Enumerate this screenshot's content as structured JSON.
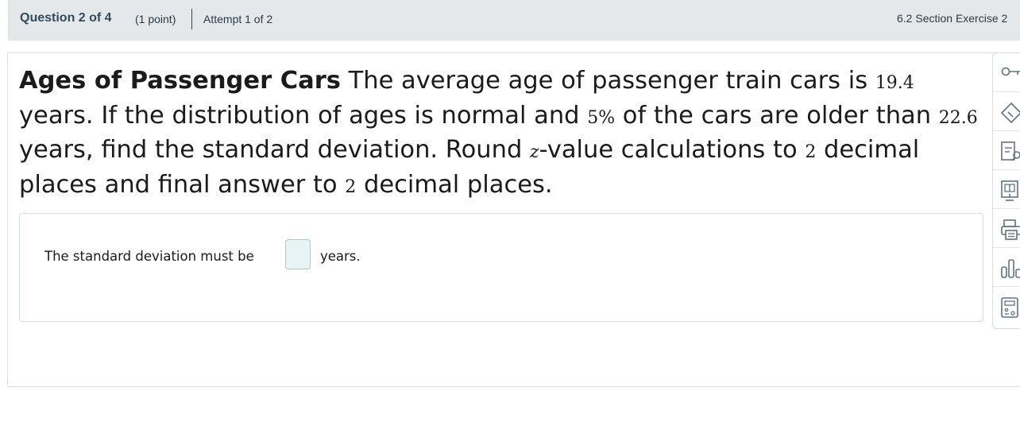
{
  "header": {
    "question_label": "Question 2 of 4",
    "points": "(1 point)",
    "attempt": "Attempt 1 of 2",
    "section": "6.2 Section Exercise 2"
  },
  "question": {
    "title": "Ages of Passenger Cars",
    "t1": " The average age of passenger train cars is ",
    "mean": "19.4",
    "t2": " years. If the distribution of ages is normal and ",
    "percent": "5%",
    "t3": " of the cars are older than ",
    "cutoff": "22.6",
    "t4": " years, find the standard deviation. Round ",
    "z_var": "z",
    "t5": "-value calculations to ",
    "z_places": "2",
    "t6": " decimal places and final answer to ",
    "final_places": "2",
    "t7": " decimal places."
  },
  "answer": {
    "prefix": "The standard deviation must be",
    "value": "",
    "suffix": "years."
  },
  "toolbar": {
    "tools": [
      "key-icon",
      "eraser-icon",
      "notes-search-icon",
      "ebook-icon",
      "print-icon",
      "statistics-chart-icon",
      "calculator-icon"
    ]
  },
  "colors": {
    "header_bg": "#e5e8ea",
    "header_text": "#324a5e",
    "input_bg": "#e8f3f6",
    "icon_color": "#607380"
  }
}
